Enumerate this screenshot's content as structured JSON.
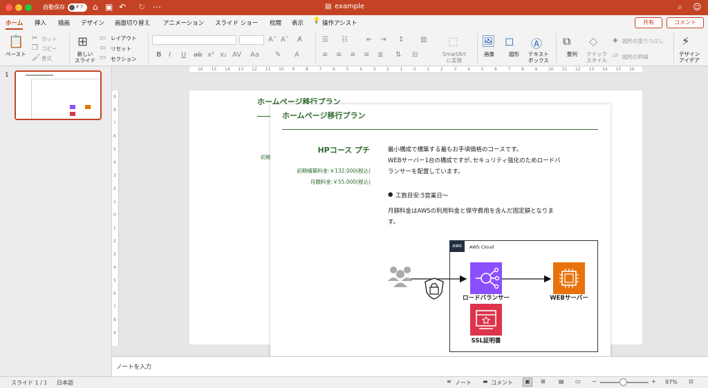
{
  "titlebar": {
    "autosave_label": "自動保存",
    "autosave_state": "オフ",
    "doc_title": "example"
  },
  "tabs": [
    "ホーム",
    "挿入",
    "描画",
    "デザイン",
    "画面切り替え",
    "アニメーション",
    "スライド ショー",
    "校閲",
    "表示",
    "操作アシスト"
  ],
  "share_label": "共有",
  "comment_label": "コメント",
  "toolbar": {
    "paste": "ペースト",
    "cut": "カット",
    "copy": "コピー",
    "format": "書式",
    "new_slide": "新しい\nスライド",
    "layout": "レイアウト",
    "reset": "リセット",
    "section": "セクション",
    "smartart": "SmartArt\nに変換",
    "image": "画像",
    "shape": "図形",
    "textbox": "テキスト\nボックス",
    "arrange": "整列",
    "quick_style": "クイック\nスタイル",
    "shape_fill": "図形の塗りつぶし",
    "shape_outline": "図形の枠線",
    "design_ideas": "デザイン\nアイデア"
  },
  "thumbnail_number": "1",
  "ruler_h": [
    "16",
    "15",
    "14",
    "13",
    "12",
    "11",
    "10",
    "9",
    "8",
    "7",
    "6",
    "5",
    "4",
    "3",
    "2",
    "1",
    "0",
    "1",
    "2",
    "3",
    "4",
    "5",
    "6",
    "7",
    "8",
    "9",
    "10",
    "11",
    "12",
    "13",
    "14",
    "15",
    "16"
  ],
  "ruler_v": [
    "9",
    "8",
    "7",
    "6",
    "5",
    "4",
    "3",
    "2",
    "1",
    "0",
    "1",
    "2",
    "3",
    "4",
    "5",
    "6",
    "7",
    "8",
    "9"
  ],
  "slide_back": {
    "title": "ホームページ移行プラン",
    "left_fragment": "初期"
  },
  "slide": {
    "title": "ホームページ移行プラン",
    "course_name": "HPコース プチ",
    "initial_fee": "初期構築料金:￥132,000(税込)",
    "monthly_fee": "月額料金:￥55,000(税込)",
    "desc1": "最小構成で構築する最もお手頃価格のコースです。",
    "desc2": "WEBサーバー1台の構成ですが､セキュリティ強化のためロードバ",
    "desc3": "ランサーを配置しています。",
    "bullet": "工数目安:5営業日～",
    "desc4": "月額料金はAWSの利用料金と保守費用を含んだ固定額となりま",
    "desc5": "す。",
    "aws_logo": "aws",
    "aws_cloud_label": "AWS Cloud",
    "lb_label": "ロードバランサー",
    "web_label": "WEBサーバー",
    "ssl_label": "SSL証明書"
  },
  "notes_placeholder": "ノートを入力",
  "statusbar": {
    "slide_info": "スライド 1 / 1",
    "language": "日本語",
    "notes": "ノート",
    "comments": "コメント",
    "zoom": "97%"
  },
  "colors": {
    "accent": "#c44325",
    "green": "#2e6b2e",
    "lb_purple": "#8c4fff",
    "web_orange": "#e8720c",
    "ssl_red": "#dd344c"
  }
}
